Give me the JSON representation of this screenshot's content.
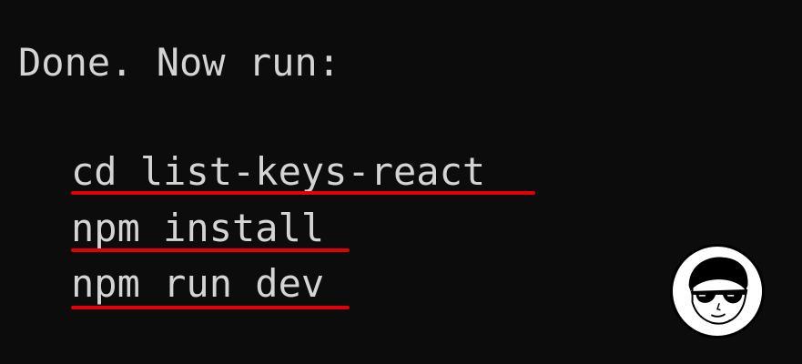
{
  "terminal": {
    "message": "Done. Now run:",
    "commands": [
      "cd list-keys-react",
      "npm install",
      "npm run dev"
    ]
  },
  "colors": {
    "background": "#0c0c0c",
    "text": "#d4d4d4",
    "underline": "#e0000b"
  },
  "icons": {
    "avatar": "sunglasses-avatar-icon"
  }
}
